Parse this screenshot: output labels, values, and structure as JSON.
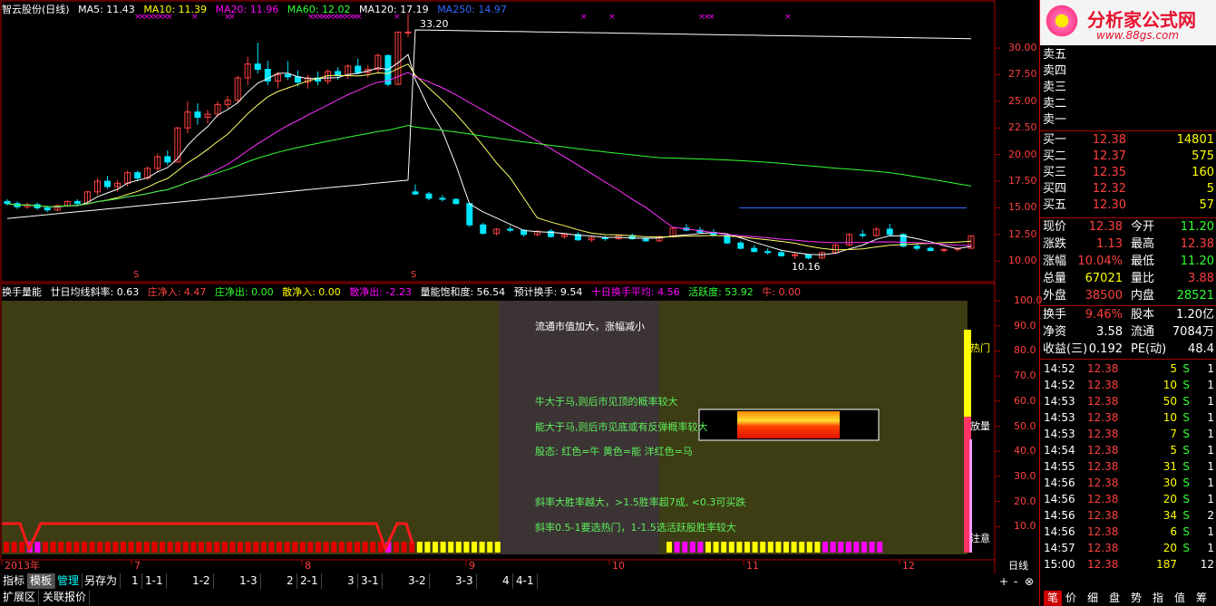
{
  "legend_main": {
    "name": "智云股份(日线)",
    "ma5": "MA5: 11.43",
    "ma10": "MA10: 11.39",
    "ma20": "MA20: 11.96",
    "ma60": "MA60: 12.02",
    "ma120": "MA120: 17.19",
    "ma250": "MA250: 14.97"
  },
  "legend_ind": {
    "name": "换手量能",
    "slope": "廿日均线斜率: 0.63",
    "zjr": "庄净入: 4.47",
    "zjc": "庄净出: 0.00",
    "sjr": "散净入: 0.00",
    "sjc": "散净出: -2.23",
    "bhd": "量能饱和度: 56.54",
    "yjhs": "预计换手: 9.54",
    "shpj": "十日换手平均: 4.56",
    "hyd": "活跃度: 53.92",
    "niu": "牛: 0.00"
  },
  "annotations": {
    "high": "33.20",
    "low": "10.16",
    "hot": "热门",
    "fangliang": "放量",
    "zhuyi": "注意",
    "mark_s1": "S",
    "mark_s2": "S"
  },
  "notes": [
    "流通市值加大，涨幅减小",
    "牛大于马,则后市见顶的概率较大",
    "能大于马,则后市见底或有反弹概率较大",
    "股态: 红色=牛 黄色=能 洋红色=马",
    "斜率大胜率越大，>1.5胜率超7成, <0.3可买跌",
    "斜率0.5-1要选热门，1-1.5选活跃股胜率较大"
  ],
  "price_axis": [
    "30.00",
    "27.50",
    "25.00",
    "22.50",
    "20.00",
    "17.50",
    "15.00",
    "12.50",
    "10.00"
  ],
  "ind_axis": [
    "100.0",
    "90.0",
    "80.0",
    "70.0",
    "60.0",
    "50.0",
    "40.0",
    "30.0",
    "20.0",
    "10.0"
  ],
  "time_axis": [
    {
      "label": "2013年"
    },
    {
      "label": "7"
    },
    {
      "label": "8"
    },
    {
      "label": "9"
    },
    {
      "label": "10"
    },
    {
      "label": "11"
    },
    {
      "label": "12"
    }
  ],
  "freq_label": "日线",
  "watermark": {
    "title": "分析家公式网",
    "url": "www.88gs.com"
  },
  "orderbook": {
    "sell": [
      {
        "label": "卖五",
        "price": "",
        "vol": ""
      },
      {
        "label": "卖四",
        "price": "",
        "vol": ""
      },
      {
        "label": "卖三",
        "price": "",
        "vol": ""
      },
      {
        "label": "卖二",
        "price": "",
        "vol": ""
      },
      {
        "label": "卖一",
        "price": "",
        "vol": ""
      }
    ],
    "buy": [
      {
        "label": "买一",
        "price": "12.38",
        "vol": "14801"
      },
      {
        "label": "买二",
        "price": "12.37",
        "vol": "575"
      },
      {
        "label": "买三",
        "price": "12.35",
        "vol": "160"
      },
      {
        "label": "买四",
        "price": "12.32",
        "vol": "5"
      },
      {
        "label": "买五",
        "price": "12.30",
        "vol": "57"
      }
    ]
  },
  "quote": [
    {
      "l1": "现价",
      "v1": "12.38",
      "l2": "今开",
      "v2": "11.20"
    },
    {
      "l1": "涨跌",
      "v1": "1.13",
      "l2": "最高",
      "v2": "12.38"
    },
    {
      "l1": "涨幅",
      "v1": "10.04%",
      "l2": "最低",
      "v2": "11.20"
    },
    {
      "l1": "总量",
      "v1": "67021",
      "l2": "量比",
      "v2": "3.88"
    },
    {
      "l1": "外盘",
      "v1": "38500",
      "l2": "内盘",
      "v2": "28521"
    }
  ],
  "quote2": [
    {
      "l1": "换手",
      "v1": "9.46%",
      "l2": "股本",
      "v2": "1.20亿"
    },
    {
      "l1": "净资",
      "v1": "3.58",
      "l2": "流通",
      "v2": "7084万"
    },
    {
      "l1": "收益(三)",
      "v1": "0.192",
      "l2": "PE(动)",
      "v2": "48.4"
    }
  ],
  "ticks": [
    {
      "t": "14:52",
      "p": "12.38",
      "v": "5",
      "s": "S",
      "n": "1"
    },
    {
      "t": "14:52",
      "p": "12.38",
      "v": "10",
      "s": "S",
      "n": "1"
    },
    {
      "t": "14:53",
      "p": "12.38",
      "v": "50",
      "s": "S",
      "n": "1"
    },
    {
      "t": "14:53",
      "p": "12.38",
      "v": "10",
      "s": "S",
      "n": "1"
    },
    {
      "t": "14:53",
      "p": "12.38",
      "v": "7",
      "s": "S",
      "n": "1"
    },
    {
      "t": "14:54",
      "p": "12.38",
      "v": "5",
      "s": "S",
      "n": "1"
    },
    {
      "t": "14:55",
      "p": "12.38",
      "v": "31",
      "s": "S",
      "n": "1"
    },
    {
      "t": "14:56",
      "p": "12.38",
      "v": "30",
      "s": "S",
      "n": "1"
    },
    {
      "t": "14:56",
      "p": "12.38",
      "v": "20",
      "s": "S",
      "n": "1"
    },
    {
      "t": "14:56",
      "p": "12.38",
      "v": "34",
      "s": "S",
      "n": "2"
    },
    {
      "t": "14:56",
      "p": "12.38",
      "v": "6",
      "s": "S",
      "n": "1"
    },
    {
      "t": "14:57",
      "p": "12.38",
      "v": "20",
      "s": "S",
      "n": "1"
    },
    {
      "t": "15:00",
      "p": "12.38",
      "v": "187",
      "s": "",
      "n": "12"
    }
  ],
  "tabs": [
    "指标",
    "模板",
    "管理",
    "另存为",
    "1",
    "1-1",
    "1-2",
    "1-3",
    "2",
    "2-1",
    "3",
    "3-1",
    "3-2",
    "3-3",
    "4",
    "4-1"
  ],
  "tabs2": [
    "扩展区",
    "关联报价"
  ],
  "right_tabs": [
    "笔",
    "价",
    "细",
    "盘",
    "势",
    "指",
    "值",
    "筹"
  ],
  "nav_buttons": {
    "plus": "+",
    "minus": "-",
    "cross": "⊗"
  },
  "colors": {
    "up": "#ff4040",
    "down": "#00e5ff",
    "ma5": "#ffffff",
    "ma10": "#ffff66",
    "ma20": "#ff33ff",
    "ma60": "#33ff33",
    "ma120": "#ffffff",
    "ma250": "#3366ff",
    "panel": "#3d3d14",
    "grey": "#3c3334"
  },
  "chart_data": {
    "type": "candlestick",
    "price_range": [
      9,
      34
    ],
    "candles": [
      [
        15.6,
        15.8,
        15.2,
        15.4
      ],
      [
        15.4,
        15.6,
        14.9,
        15.1
      ],
      [
        15.1,
        15.5,
        14.9,
        15.3
      ],
      [
        15.3,
        15.5,
        14.8,
        15.0
      ],
      [
        15.0,
        15.2,
        14.6,
        14.8
      ],
      [
        14.8,
        15.3,
        14.7,
        15.2
      ],
      [
        15.2,
        15.7,
        15.1,
        15.6
      ],
      [
        15.6,
        15.8,
        15.2,
        15.4
      ],
      [
        15.4,
        16.6,
        15.3,
        16.5
      ],
      [
        16.5,
        17.8,
        16.2,
        17.5
      ],
      [
        17.5,
        18.0,
        16.8,
        17.0
      ],
      [
        17.0,
        17.6,
        16.5,
        17.3
      ],
      [
        17.3,
        18.5,
        17.0,
        18.3
      ],
      [
        18.3,
        18.5,
        17.5,
        17.8
      ],
      [
        17.8,
        18.9,
        17.6,
        18.7
      ],
      [
        18.7,
        20.1,
        18.4,
        19.8
      ],
      [
        19.8,
        20.4,
        19.0,
        19.3
      ],
      [
        19.3,
        22.6,
        19.3,
        22.5
      ],
      [
        22.5,
        25.0,
        22.0,
        24.0
      ],
      [
        24.0,
        24.8,
        22.8,
        23.5
      ],
      [
        23.5,
        24.2,
        22.9,
        23.8
      ],
      [
        23.8,
        25.0,
        23.5,
        24.7
      ],
      [
        24.7,
        25.5,
        24.3,
        25.1
      ],
      [
        25.1,
        27.4,
        24.8,
        27.2
      ],
      [
        27.2,
        29.2,
        26.5,
        28.5
      ],
      [
        28.5,
        30.5,
        27.6,
        28.0
      ],
      [
        28.0,
        28.8,
        26.5,
        26.9
      ],
      [
        26.9,
        27.8,
        26.2,
        27.5
      ],
      [
        27.5,
        28.8,
        27.0,
        27.3
      ],
      [
        27.3,
        27.9,
        26.4,
        26.8
      ],
      [
        26.8,
        27.5,
        26.2,
        27.2
      ],
      [
        27.2,
        27.8,
        26.5,
        26.9
      ],
      [
        26.9,
        28.0,
        26.6,
        27.8
      ],
      [
        27.8,
        28.2,
        27.0,
        27.4
      ],
      [
        27.4,
        28.5,
        27.1,
        28.3
      ],
      [
        28.3,
        29.0,
        27.5,
        27.7
      ],
      [
        27.7,
        28.4,
        27.2,
        28.0
      ],
      [
        28.0,
        29.5,
        27.6,
        29.3
      ],
      [
        29.3,
        29.4,
        26.4,
        26.6
      ],
      [
        26.6,
        31.5,
        26.5,
        31.5
      ],
      [
        31.5,
        33.2,
        31.0,
        31.5
      ],
      [
        16.5,
        17.2,
        16.2,
        16.3
      ],
      [
        16.3,
        16.5,
        15.7,
        15.9
      ],
      [
        15.9,
        16.2,
        15.6,
        15.8
      ],
      [
        15.8,
        15.9,
        15.3,
        15.4
      ],
      [
        15.4,
        15.5,
        13.2,
        13.4
      ],
      [
        13.4,
        13.6,
        12.5,
        12.6
      ],
      [
        12.6,
        13.1,
        12.4,
        13.0
      ],
      [
        13.0,
        13.3,
        12.7,
        12.9
      ],
      [
        12.9,
        13.0,
        12.3,
        12.5
      ],
      [
        12.5,
        12.9,
        12.3,
        12.8
      ],
      [
        12.8,
        13.0,
        12.2,
        12.3
      ],
      [
        12.3,
        12.6,
        12.1,
        12.5
      ],
      [
        12.5,
        12.7,
        11.9,
        12.0
      ],
      [
        12.0,
        12.3,
        11.8,
        12.2
      ],
      [
        12.2,
        12.4,
        11.9,
        12.1
      ],
      [
        12.1,
        12.5,
        12.0,
        12.4
      ],
      [
        12.4,
        12.6,
        12.0,
        12.1
      ],
      [
        12.1,
        12.3,
        11.8,
        11.9
      ],
      [
        11.9,
        12.4,
        11.8,
        12.3
      ],
      [
        12.3,
        13.2,
        12.2,
        13.1
      ],
      [
        13.1,
        13.5,
        12.8,
        12.9
      ],
      [
        12.9,
        13.2,
        12.6,
        12.7
      ],
      [
        12.7,
        13.0,
        12.3,
        12.4
      ],
      [
        12.4,
        12.5,
        11.6,
        11.7
      ],
      [
        11.7,
        11.9,
        11.1,
        11.2
      ],
      [
        11.2,
        11.5,
        10.8,
        10.9
      ],
      [
        10.9,
        11.2,
        10.6,
        10.8
      ],
      [
        10.8,
        11.0,
        10.4,
        10.5
      ],
      [
        10.5,
        10.8,
        10.2,
        10.6
      ],
      [
        10.6,
        10.7,
        10.16,
        10.3
      ],
      [
        10.3,
        10.9,
        10.2,
        10.8
      ],
      [
        10.8,
        11.6,
        10.7,
        11.5
      ],
      [
        11.5,
        12.6,
        11.4,
        12.5
      ],
      [
        12.5,
        12.9,
        12.2,
        12.4
      ],
      [
        12.4,
        13.2,
        12.3,
        13.0
      ],
      [
        13.0,
        13.5,
        12.4,
        12.5
      ],
      [
        12.5,
        12.6,
        11.3,
        11.4
      ],
      [
        11.4,
        11.6,
        11.0,
        11.2
      ],
      [
        11.2,
        11.4,
        10.9,
        11.0
      ],
      [
        11.0,
        11.2,
        10.8,
        11.1
      ],
      [
        11.1,
        11.3,
        10.9,
        11.2
      ],
      [
        11.2,
        12.38,
        11.2,
        12.38
      ]
    ]
  }
}
